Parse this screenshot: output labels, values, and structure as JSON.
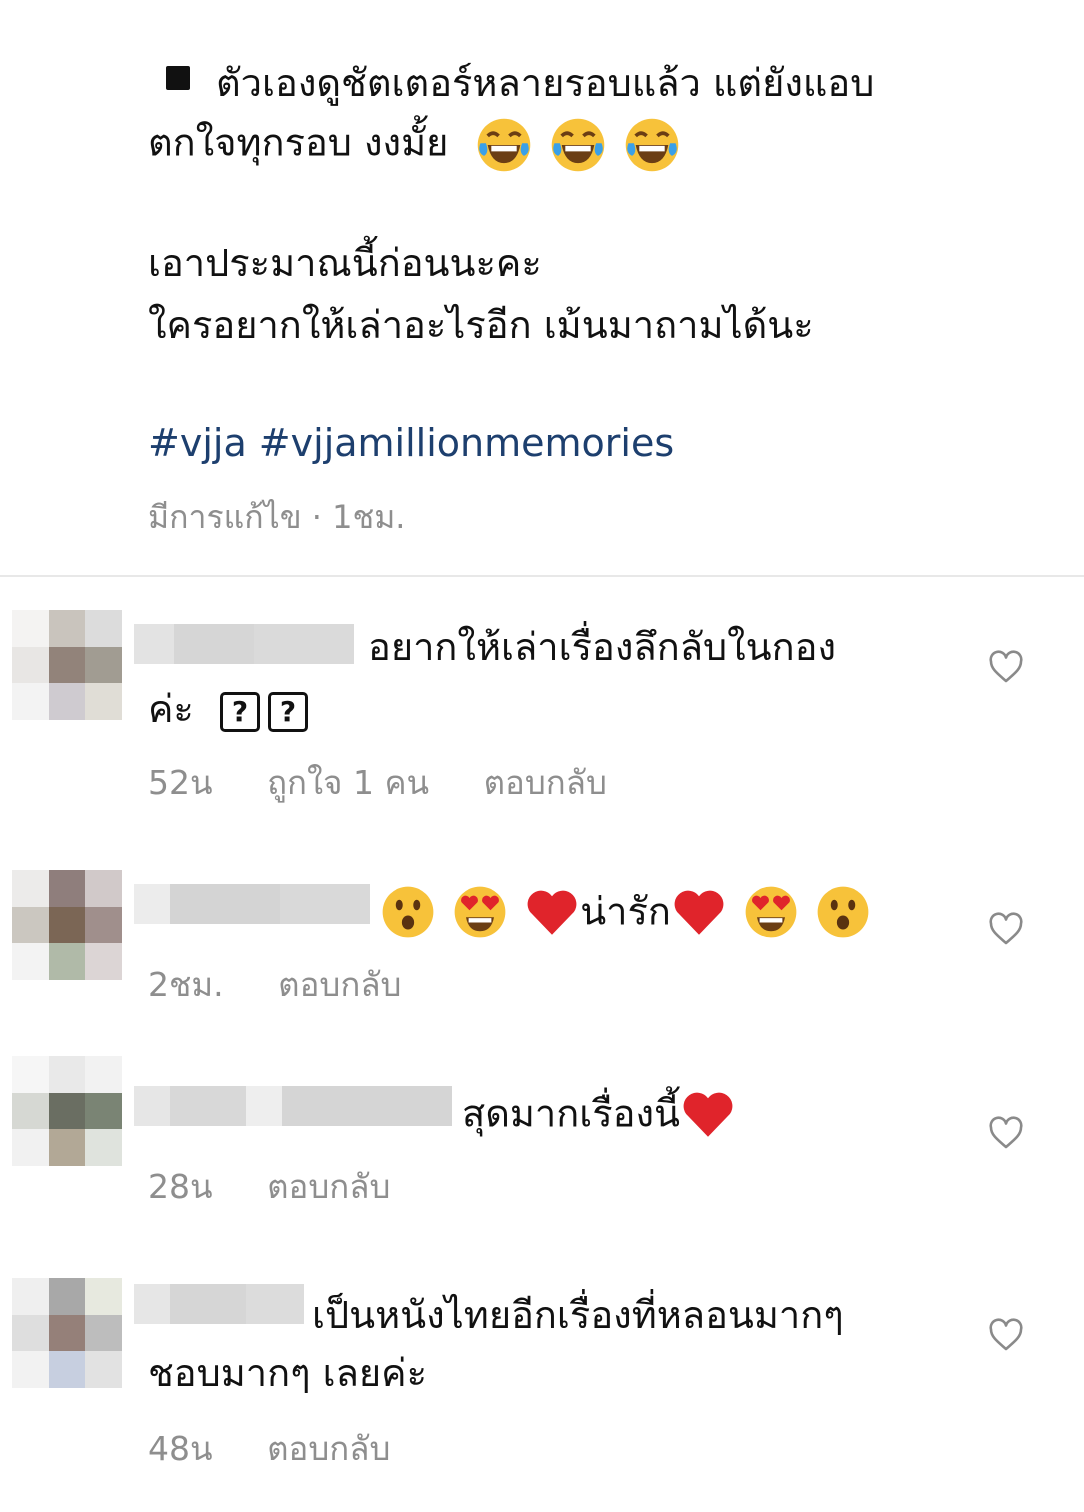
{
  "post": {
    "caption_line1": "ตัวเองดูชัตเตอร์หลายรอบแล้ว แต่ยังแอบ",
    "caption_line2": "ตกใจทุกรอบ งงมั้ย",
    "caption_line3": "เอาประมาณนี้ก่อนนะคะ",
    "caption_line4": "ใครอยากให้เล่าอะไรอีก เม้นมาถามได้นะ",
    "hashtags": "#vjja #vjjamillionmemories",
    "meta": "มีการแก้ไข · 1ชม."
  },
  "comments": [
    {
      "text_line1": "อยากให้เล่าเรื่องลึกลับในกอง",
      "text_line2": "ค่ะ",
      "time": "52น",
      "likes": "ถูกใจ 1 คน",
      "reply": "ตอบกลับ"
    },
    {
      "text": "น่ารัก",
      "time": "2ชม.",
      "reply": "ตอบกลับ"
    },
    {
      "text": "สุดมากเรื่องนี้",
      "time": "28น",
      "reply": "ตอบกลับ"
    },
    {
      "text_line1": "เป็นหนังไทยอีกเรื่องที่หลอนมากๆ",
      "text_line2": "ชอบมากๆ เลยค่ะ",
      "time": "48น",
      "reply": "ตอบกลับ"
    }
  ],
  "colors": {
    "hashtag": "#1d3f6e",
    "meta_gray": "#8e8e8e",
    "heart_red": "#e0242b"
  },
  "icons": [
    "laughing-tears-emoji",
    "heart-eyes-emoji",
    "surprised-emoji",
    "red-heart-emoji",
    "heart-outline-icon",
    "question-box-icon"
  ]
}
